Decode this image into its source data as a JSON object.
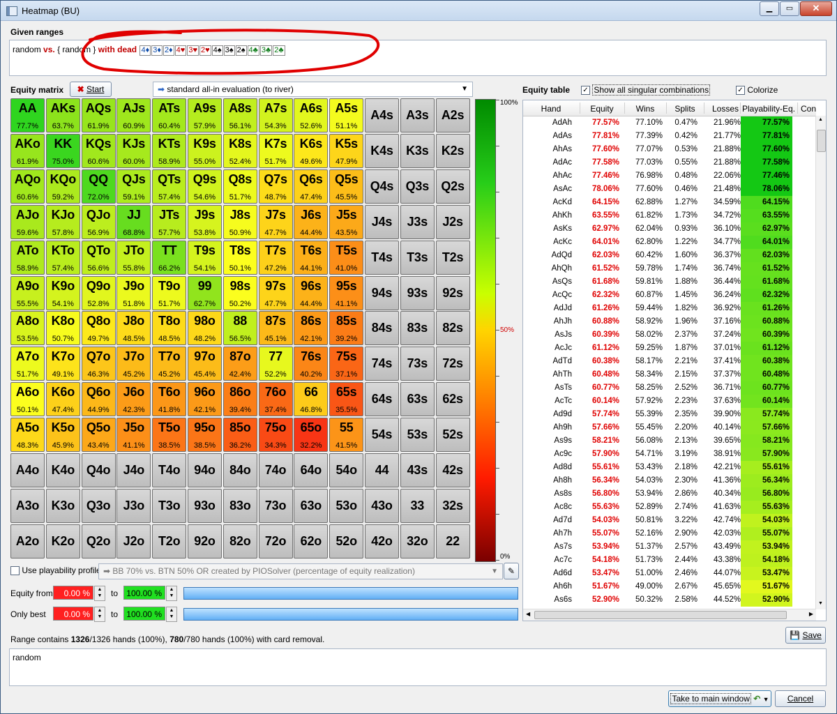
{
  "window": {
    "title": "Heatmap (BU)"
  },
  "given": {
    "label": "Given ranges",
    "range_a": "random",
    "vs": "vs.",
    "range_b": "{ random }",
    "with_dead": "with dead",
    "dead_cards": [
      {
        "text": "4♦",
        "suit": "d"
      },
      {
        "text": "3♦",
        "suit": "d"
      },
      {
        "text": "2♦",
        "suit": "d"
      },
      {
        "text": "4♥",
        "suit": "h"
      },
      {
        "text": "3♥",
        "suit": "h"
      },
      {
        "text": "2♥",
        "suit": "h"
      },
      {
        "text": "4♠",
        "suit": "s"
      },
      {
        "text": "3♠",
        "suit": "s"
      },
      {
        "text": "2♠",
        "suit": "s"
      },
      {
        "text": "4♣",
        "suit": "c"
      },
      {
        "text": "3♣",
        "suit": "c"
      },
      {
        "text": "2♣",
        "suit": "c"
      }
    ]
  },
  "matrix_section": {
    "label": "Equity matrix",
    "start_label": "Start",
    "evaluation": "standard all-in evaluation (to river)"
  },
  "scale": {
    "top": "100%",
    "mid": "50%",
    "bottom": "0%"
  },
  "matrix": [
    [
      [
        "AA",
        "77.7%",
        "#2fd51f"
      ],
      [
        "AKs",
        "63.7%",
        "#8ce31c"
      ],
      [
        "AQs",
        "61.9%",
        "#97e51d"
      ],
      [
        "AJs",
        "60.9%",
        "#9fe71d"
      ],
      [
        "ATs",
        "60.4%",
        "#a3e81d"
      ],
      [
        "A9s",
        "57.9%",
        "#b5ec1e"
      ],
      [
        "A8s",
        "56.1%",
        "#c1ef1e"
      ],
      [
        "A7s",
        "54.3%",
        "#d2f31e"
      ],
      [
        "A6s",
        "52.6%",
        "#e2f71e"
      ],
      [
        "A5s",
        "51.1%",
        "#f4fb1e"
      ],
      [
        "A4s",
        "",
        ""
      ],
      [
        "A3s",
        "",
        ""
      ],
      [
        "A2s",
        "",
        ""
      ]
    ],
    [
      [
        "AKo",
        "61.9%",
        "#97e51d"
      ],
      [
        "KK",
        "75.0%",
        "#3ad61f"
      ],
      [
        "KQs",
        "60.6%",
        "#a1e81d"
      ],
      [
        "KJs",
        "60.0%",
        "#a6e91d"
      ],
      [
        "KTs",
        "58.9%",
        "#aeea1e"
      ],
      [
        "K9s",
        "55.0%",
        "#ccf21e"
      ],
      [
        "K8s",
        "52.4%",
        "#e4f71e"
      ],
      [
        "K7s",
        "51.7%",
        "#edfa1e"
      ],
      [
        "K6s",
        "49.6%",
        "#fde81b"
      ],
      [
        "K5s",
        "47.9%",
        "#fdd51a"
      ],
      [
        "K4s",
        "",
        ""
      ],
      [
        "K3s",
        "",
        ""
      ],
      [
        "K2s",
        "",
        ""
      ]
    ],
    [
      [
        "AQo",
        "60.6%",
        "#a1e81d"
      ],
      [
        "KQo",
        "59.2%",
        "#acea1e"
      ],
      [
        "QQ",
        "72.0%",
        "#4ed91f"
      ],
      [
        "QJs",
        "59.1%",
        "#aceb1e"
      ],
      [
        "QTs",
        "57.4%",
        "#b9ed1e"
      ],
      [
        "Q9s",
        "54.6%",
        "#d0f31e"
      ],
      [
        "Q8s",
        "51.7%",
        "#edfa1e"
      ],
      [
        "Q7s",
        "48.7%",
        "#fddc1a"
      ],
      [
        "Q6s",
        "47.4%",
        "#fdd11a"
      ],
      [
        "Q5s",
        "45.5%",
        "#fcbd19"
      ],
      [
        "Q4s",
        "",
        ""
      ],
      [
        "Q3s",
        "",
        ""
      ],
      [
        "Q2s",
        "",
        ""
      ]
    ],
    [
      [
        "AJo",
        "59.6%",
        "#a9e91d"
      ],
      [
        "KJo",
        "57.8%",
        "#b6ec1e"
      ],
      [
        "QJo",
        "56.9%",
        "#bcee1e"
      ],
      [
        "JJ",
        "68.8%",
        "#67dd1f"
      ],
      [
        "JTs",
        "57.7%",
        "#b7ec1e"
      ],
      [
        "J9s",
        "53.8%",
        "#d6f41e"
      ],
      [
        "J8s",
        "50.9%",
        "#f6fc1e"
      ],
      [
        "J7s",
        "47.7%",
        "#fdd41a"
      ],
      [
        "J6s",
        "44.4%",
        "#fcb219"
      ],
      [
        "J5s",
        "43.5%",
        "#fca919"
      ],
      [
        "J4s",
        "",
        ""
      ],
      [
        "J3s",
        "",
        ""
      ],
      [
        "J2s",
        "",
        ""
      ]
    ],
    [
      [
        "ATo",
        "58.9%",
        "#aeea1e"
      ],
      [
        "KTo",
        "57.4%",
        "#b9ed1e"
      ],
      [
        "QTo",
        "56.6%",
        "#bfee1e"
      ],
      [
        "JTo",
        "55.8%",
        "#c4f01e"
      ],
      [
        "TT",
        "66.2%",
        "#7ae01f"
      ],
      [
        "T9s",
        "54.1%",
        "#d4f31e"
      ],
      [
        "T8s",
        "50.1%",
        "#fcfe1e"
      ],
      [
        "T7s",
        "47.2%",
        "#fdd01a"
      ],
      [
        "T6s",
        "44.1%",
        "#fcaf19"
      ],
      [
        "T5s",
        "41.0%",
        "#fc8e18"
      ],
      [
        "T4s",
        "",
        ""
      ],
      [
        "T3s",
        "",
        ""
      ],
      [
        "T2s",
        "",
        ""
      ]
    ],
    [
      [
        "A9o",
        "55.5%",
        "#c7f01e"
      ],
      [
        "K9o",
        "54.1%",
        "#d4f31e"
      ],
      [
        "Q9o",
        "52.8%",
        "#e1f61e"
      ],
      [
        "J9o",
        "51.8%",
        "#ebf91e"
      ],
      [
        "T9o",
        "51.7%",
        "#edfa1e"
      ],
      [
        "99",
        "62.7%",
        "#91e41d"
      ],
      [
        "98s",
        "50.2%",
        "#fbfe1e"
      ],
      [
        "97s",
        "47.7%",
        "#fdd41a"
      ],
      [
        "96s",
        "44.4%",
        "#fcb219"
      ],
      [
        "95s",
        "41.1%",
        "#fc8f18"
      ],
      [
        "94s",
        "",
        ""
      ],
      [
        "93s",
        "",
        ""
      ],
      [
        "92s",
        "",
        ""
      ]
    ],
    [
      [
        "A8o",
        "53.5%",
        "#d8f41e"
      ],
      [
        "K8o",
        "50.7%",
        "#f7fc1e"
      ],
      [
        "Q8o",
        "49.7%",
        "#fde91b"
      ],
      [
        "J8o",
        "48.5%",
        "#fddb1a"
      ],
      [
        "T8o",
        "48.5%",
        "#fddb1a"
      ],
      [
        "98o",
        "48.2%",
        "#fdd81a"
      ],
      [
        "88",
        "56.5%",
        "#c0ef1e"
      ],
      [
        "87s",
        "45.1%",
        "#fcba19"
      ],
      [
        "86s",
        "42.1%",
        "#fc9a18"
      ],
      [
        "85s",
        "39.2%",
        "#fb7c17"
      ],
      [
        "84s",
        "",
        ""
      ],
      [
        "83s",
        "",
        ""
      ],
      [
        "82s",
        "",
        ""
      ]
    ],
    [
      [
        "A7o",
        "51.7%",
        "#edfa1e"
      ],
      [
        "K7o",
        "49.1%",
        "#fde31b"
      ],
      [
        "Q7o",
        "46.3%",
        "#fcc61a"
      ],
      [
        "J7o",
        "45.2%",
        "#fcbb19"
      ],
      [
        "T7o",
        "45.2%",
        "#fcbb19"
      ],
      [
        "97o",
        "45.4%",
        "#fcbc19"
      ],
      [
        "87o",
        "42.4%",
        "#fc9d18"
      ],
      [
        "77",
        "52.2%",
        "#e7f81e"
      ],
      [
        "76s",
        "40.2%",
        "#fb8617"
      ],
      [
        "75s",
        "37.1%",
        "#fa6616"
      ],
      [
        "74s",
        "",
        ""
      ],
      [
        "73s",
        "",
        ""
      ],
      [
        "72s",
        "",
        ""
      ]
    ],
    [
      [
        "A6o",
        "50.1%",
        "#fcfe1e"
      ],
      [
        "K6o",
        "47.4%",
        "#fdd11a"
      ],
      [
        "Q6o",
        "44.9%",
        "#fcb819"
      ],
      [
        "J6o",
        "42.3%",
        "#fc9c18"
      ],
      [
        "T6o",
        "41.8%",
        "#fc9718"
      ],
      [
        "96o",
        "42.1%",
        "#fc9a18"
      ],
      [
        "86o",
        "39.4%",
        "#fb7e17"
      ],
      [
        "76o",
        "37.4%",
        "#fa6916"
      ],
      [
        "66",
        "46.8%",
        "#fdcb1a"
      ],
      [
        "65s",
        "35.5%",
        "#f95616"
      ],
      [
        "64s",
        "",
        ""
      ],
      [
        "63s",
        "",
        ""
      ],
      [
        "62s",
        "",
        ""
      ]
    ],
    [
      [
        "A5o",
        "48.3%",
        "#fdd91a"
      ],
      [
        "K5o",
        "45.9%",
        "#fcc21a"
      ],
      [
        "Q5o",
        "43.4%",
        "#fca819"
      ],
      [
        "J5o",
        "41.1%",
        "#fc8f18"
      ],
      [
        "T5o",
        "38.5%",
        "#fb7517"
      ],
      [
        "95o",
        "38.5%",
        "#fb7517"
      ],
      [
        "85o",
        "36.2%",
        "#fa5d16"
      ],
      [
        "75o",
        "34.3%",
        "#f94a15"
      ],
      [
        "65o",
        "32.2%",
        "#f83515"
      ],
      [
        "55",
        "41.5%",
        "#fc9418"
      ],
      [
        "54s",
        "",
        ""
      ],
      [
        "53s",
        "",
        ""
      ],
      [
        "52s",
        "",
        ""
      ]
    ],
    [
      [
        "A4o",
        "",
        ""
      ],
      [
        "K4o",
        "",
        ""
      ],
      [
        "Q4o",
        "",
        ""
      ],
      [
        "J4o",
        "",
        ""
      ],
      [
        "T4o",
        "",
        ""
      ],
      [
        "94o",
        "",
        ""
      ],
      [
        "84o",
        "",
        ""
      ],
      [
        "74o",
        "",
        ""
      ],
      [
        "64o",
        "",
        ""
      ],
      [
        "54o",
        "",
        ""
      ],
      [
        "44",
        "",
        ""
      ],
      [
        "43s",
        "",
        ""
      ],
      [
        "42s",
        "",
        ""
      ]
    ],
    [
      [
        "A3o",
        "",
        ""
      ],
      [
        "K3o",
        "",
        ""
      ],
      [
        "Q3o",
        "",
        ""
      ],
      [
        "J3o",
        "",
        ""
      ],
      [
        "T3o",
        "",
        ""
      ],
      [
        "93o",
        "",
        ""
      ],
      [
        "83o",
        "",
        ""
      ],
      [
        "73o",
        "",
        ""
      ],
      [
        "63o",
        "",
        ""
      ],
      [
        "53o",
        "",
        ""
      ],
      [
        "43o",
        "",
        ""
      ],
      [
        "33",
        "",
        ""
      ],
      [
        "32s",
        "",
        ""
      ]
    ],
    [
      [
        "A2o",
        "",
        ""
      ],
      [
        "K2o",
        "",
        ""
      ],
      [
        "Q2o",
        "",
        ""
      ],
      [
        "J2o",
        "",
        ""
      ],
      [
        "T2o",
        "",
        ""
      ],
      [
        "92o",
        "",
        ""
      ],
      [
        "82o",
        "",
        ""
      ],
      [
        "72o",
        "",
        ""
      ],
      [
        "62o",
        "",
        ""
      ],
      [
        "52o",
        "",
        ""
      ],
      [
        "42o",
        "",
        ""
      ],
      [
        "32o",
        "",
        ""
      ],
      [
        "22",
        "",
        ""
      ]
    ]
  ],
  "equity_table": {
    "label": "Equity table",
    "show_all_label": "Show all singular combinations",
    "colorize_label": "Colorize",
    "columns": [
      "Hand",
      "Equity",
      "Wins",
      "Splits",
      "Losses",
      "Playability-Eq.",
      "Con"
    ],
    "rows": [
      [
        "AdAh",
        "77.57%",
        "77.10%",
        "0.47%",
        "21.96%",
        "77.57%",
        "#14c814"
      ],
      [
        "AdAs",
        "77.81%",
        "77.39%",
        "0.42%",
        "21.77%",
        "77.81%",
        "#14c814"
      ],
      [
        "AhAs",
        "77.60%",
        "77.07%",
        "0.53%",
        "21.88%",
        "77.60%",
        "#14c814"
      ],
      [
        "AdAc",
        "77.58%",
        "77.03%",
        "0.55%",
        "21.88%",
        "77.58%",
        "#14c814"
      ],
      [
        "AhAc",
        "77.46%",
        "76.98%",
        "0.48%",
        "22.06%",
        "77.46%",
        "#14c814"
      ],
      [
        "AsAc",
        "78.06%",
        "77.60%",
        "0.46%",
        "21.48%",
        "78.06%",
        "#14c814"
      ],
      [
        "AcKd",
        "64.15%",
        "62.88%",
        "1.27%",
        "34.59%",
        "64.15%",
        "#4fdc1e"
      ],
      [
        "AhKh",
        "63.55%",
        "61.82%",
        "1.73%",
        "34.72%",
        "63.55%",
        "#55de1e"
      ],
      [
        "AsKs",
        "62.97%",
        "62.04%",
        "0.93%",
        "36.10%",
        "62.97%",
        "#5ade1e"
      ],
      [
        "AcKc",
        "64.01%",
        "62.80%",
        "1.22%",
        "34.77%",
        "64.01%",
        "#50dc1e"
      ],
      [
        "AdQd",
        "62.03%",
        "60.42%",
        "1.60%",
        "36.37%",
        "62.03%",
        "#62e01e"
      ],
      [
        "AhQh",
        "61.52%",
        "59.78%",
        "1.74%",
        "36.74%",
        "61.52%",
        "#66e11e"
      ],
      [
        "AsQs",
        "61.68%",
        "59.81%",
        "1.88%",
        "36.44%",
        "61.68%",
        "#64e11e"
      ],
      [
        "AcQc",
        "62.32%",
        "60.87%",
        "1.45%",
        "36.24%",
        "62.32%",
        "#5fe01e"
      ],
      [
        "AdJd",
        "61.26%",
        "59.44%",
        "1.82%",
        "36.92%",
        "61.26%",
        "#69e21e"
      ],
      [
        "AhJh",
        "60.88%",
        "58.92%",
        "1.96%",
        "37.16%",
        "60.88%",
        "#6ce31e"
      ],
      [
        "AsJs",
        "60.39%",
        "58.02%",
        "2.37%",
        "37.24%",
        "60.39%",
        "#70e41e"
      ],
      [
        "AcJc",
        "61.12%",
        "59.25%",
        "1.87%",
        "37.01%",
        "61.12%",
        "#6ae21e"
      ],
      [
        "AdTd",
        "60.38%",
        "58.17%",
        "2.21%",
        "37.41%",
        "60.38%",
        "#70e41e"
      ],
      [
        "AhTh",
        "60.48%",
        "58.34%",
        "2.15%",
        "37.37%",
        "60.48%",
        "#70e41e"
      ],
      [
        "AsTs",
        "60.77%",
        "58.25%",
        "2.52%",
        "36.71%",
        "60.77%",
        "#6de31e"
      ],
      [
        "AcTc",
        "60.14%",
        "57.92%",
        "2.23%",
        "37.63%",
        "60.14%",
        "#72e41e"
      ],
      [
        "Ad9d",
        "57.74%",
        "55.39%",
        "2.35%",
        "39.90%",
        "57.74%",
        "#8ae91e"
      ],
      [
        "Ah9h",
        "57.66%",
        "55.45%",
        "2.20%",
        "40.14%",
        "57.66%",
        "#8be91e"
      ],
      [
        "As9s",
        "58.21%",
        "56.08%",
        "2.13%",
        "39.65%",
        "58.21%",
        "#86e81e"
      ],
      [
        "Ac9c",
        "57.90%",
        "54.71%",
        "3.19%",
        "38.91%",
        "57.90%",
        "#89e81e"
      ],
      [
        "Ad8d",
        "55.61%",
        "53.43%",
        "2.18%",
        "42.21%",
        "55.61%",
        "#a6ee1e"
      ],
      [
        "Ah8h",
        "56.34%",
        "54.03%",
        "2.30%",
        "41.36%",
        "56.34%",
        "#9dec1e"
      ],
      [
        "As8s",
        "56.80%",
        "53.94%",
        "2.86%",
        "40.34%",
        "56.80%",
        "#98eb1e"
      ],
      [
        "Ac8c",
        "55.63%",
        "52.89%",
        "2.74%",
        "41.63%",
        "55.63%",
        "#a6ee1e"
      ],
      [
        "Ad7d",
        "54.03%",
        "50.81%",
        "3.22%",
        "42.74%",
        "54.03%",
        "#c0f21e"
      ],
      [
        "Ah7h",
        "55.07%",
        "52.16%",
        "2.90%",
        "42.03%",
        "55.07%",
        "#b0ef1e"
      ],
      [
        "As7s",
        "53.94%",
        "51.37%",
        "2.57%",
        "43.49%",
        "53.94%",
        "#c1f21e"
      ],
      [
        "Ac7c",
        "54.18%",
        "51.73%",
        "2.44%",
        "43.38%",
        "54.18%",
        "#bef11e"
      ],
      [
        "Ad6d",
        "53.47%",
        "51.00%",
        "2.46%",
        "44.07%",
        "53.47%",
        "#c8f31e"
      ],
      [
        "Ah6h",
        "51.67%",
        "49.00%",
        "2.67%",
        "45.65%",
        "51.67%",
        "#e2f81e"
      ],
      [
        "As6s",
        "52.90%",
        "50.32%",
        "2.58%",
        "44.52%",
        "52.90%",
        "#d1f51e"
      ]
    ]
  },
  "playability": {
    "label": "Use playability profile:",
    "value": "BB 70% vs. BTN 50% OR created by PIOSolver  (percentage of equity realization)"
  },
  "filters": {
    "equity_from_label": "Equity from",
    "only_best_label": "Only best",
    "to_label": "to",
    "equity_from_min": "0.00 %",
    "equity_from_max": "100.00 %",
    "only_best_min": "0.00 %",
    "only_best_max": "100.00 %"
  },
  "summary": {
    "prefix": "Range contains ",
    "a": "1326",
    "b": "/1326 hands (100%), ",
    "c": "780",
    "d": "/780 hands (100%) with card removal."
  },
  "save_label": "Save",
  "range_text": "random",
  "buttons": {
    "take_main": "Take to main window",
    "cancel": "Cancel"
  }
}
